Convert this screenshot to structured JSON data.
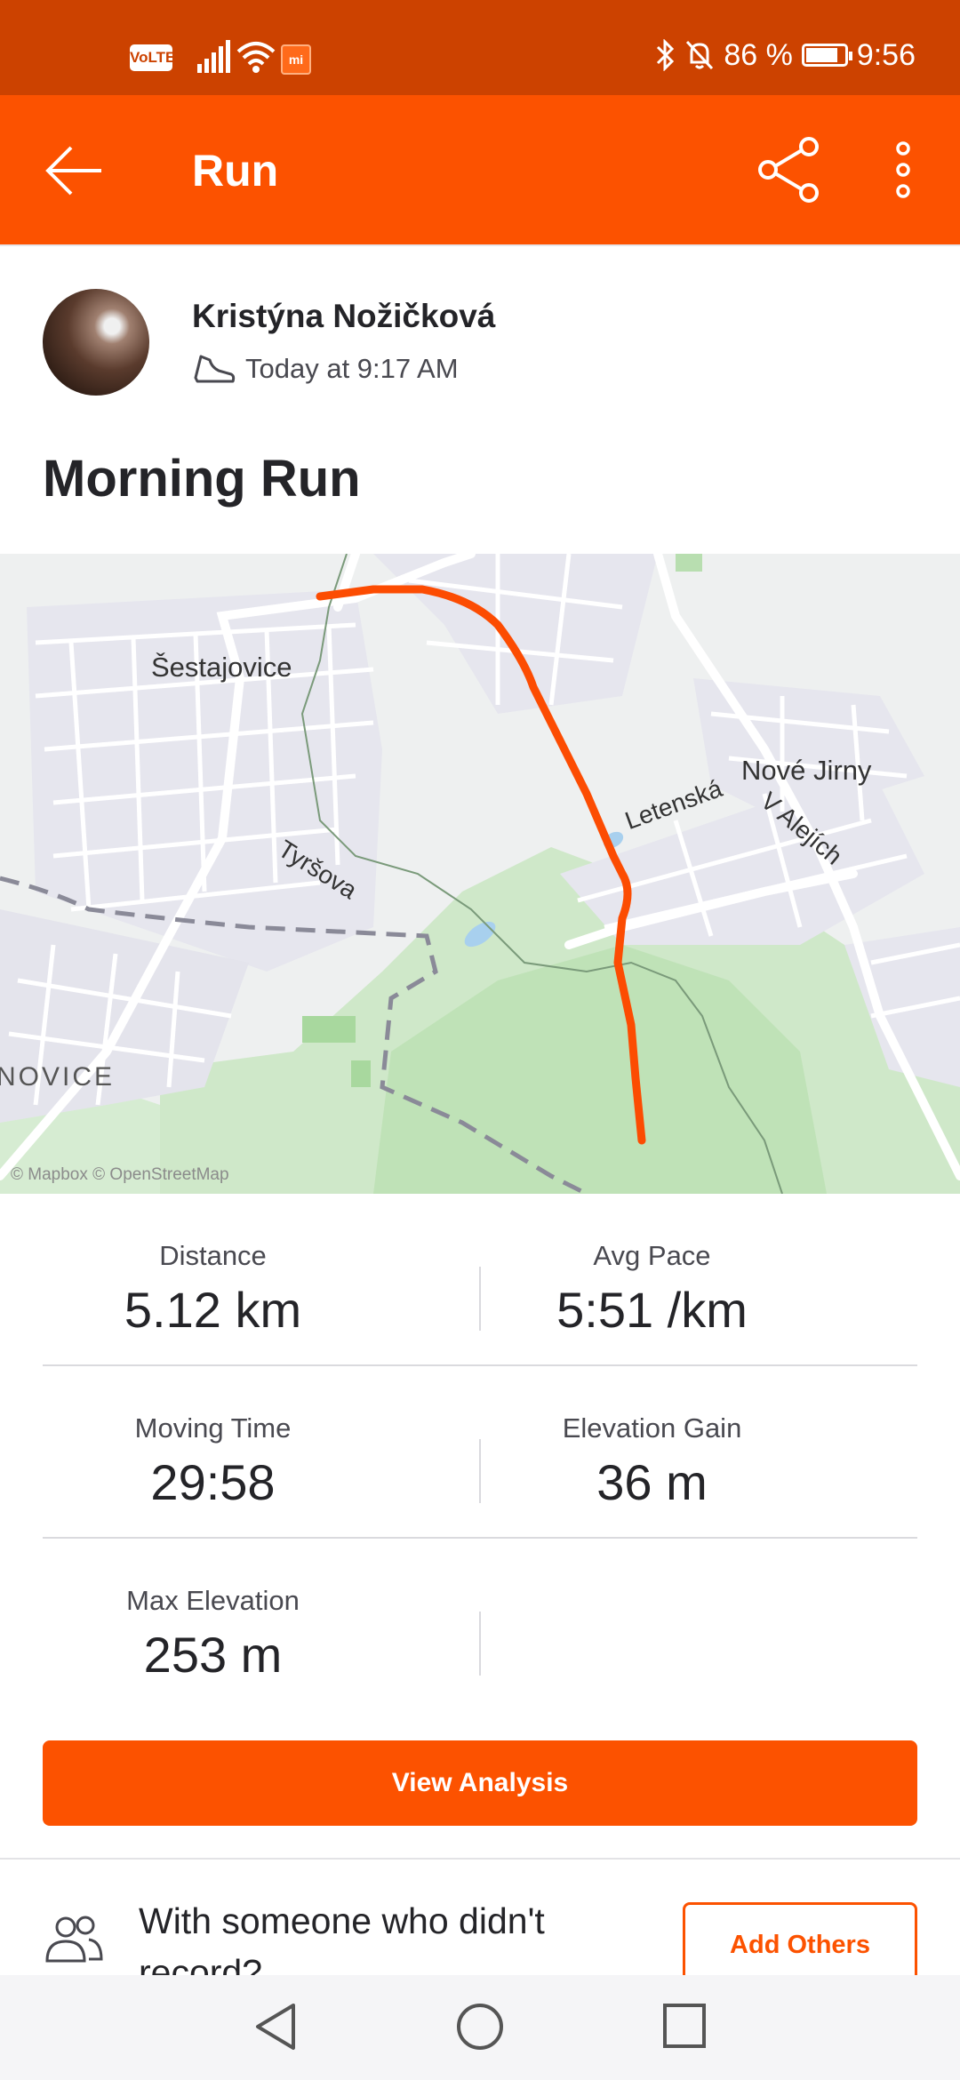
{
  "status_bar": {
    "volte": "VoLTE",
    "mi": "mi",
    "battery_percent": "86 %",
    "battery_level": 0.86,
    "time": "9:56"
  },
  "app_bar": {
    "title": "Run",
    "icons": [
      "back-arrow-icon",
      "share-icon",
      "more-vertical-icon"
    ]
  },
  "activity": {
    "athlete_name": "Kristýna Nožičková",
    "timestamp": "Today at 9:17 AM",
    "sport_icon": "shoe-icon",
    "title": "Morning Run"
  },
  "map": {
    "labels": [
      "Šestajovice",
      "Tyršova",
      "V Alejích",
      "Nové Jirny",
      "Letenská",
      "NOVICE"
    ],
    "attribution": "© Mapbox © OpenStreetMap",
    "route_color": "#fc4c02"
  },
  "stats": [
    {
      "label": "Distance",
      "value": "5.12 km"
    },
    {
      "label": "Avg Pace",
      "value": "5:51 /km"
    },
    {
      "label": "Moving Time",
      "value": "29:58"
    },
    {
      "label": "Elevation Gain",
      "value": "36 m"
    },
    {
      "label": "Max Elevation",
      "value": "253 m"
    }
  ],
  "view_analysis_label": "View Analysis",
  "others": {
    "text": "With someone who didn't record?",
    "button_label": "Add Others"
  },
  "colors": {
    "brand": "#fc5200",
    "status_bar": "#cc4200"
  }
}
